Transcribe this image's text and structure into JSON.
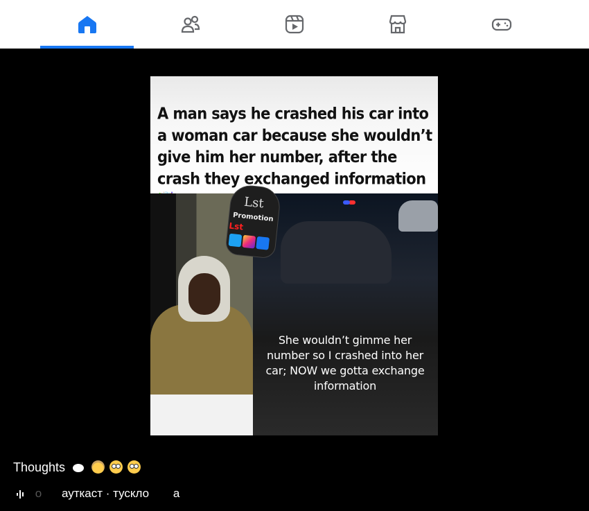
{
  "nav": {
    "tabs": [
      {
        "name": "home",
        "icon": "home-icon",
        "active": true
      },
      {
        "name": "friends",
        "icon": "friends-icon",
        "active": false
      },
      {
        "name": "reels",
        "icon": "reels-icon",
        "active": false
      },
      {
        "name": "marketplace",
        "icon": "marketplace-icon",
        "active": false
      },
      {
        "name": "gaming",
        "icon": "gaming-icon",
        "active": false
      }
    ],
    "accent_color": "#1877f2",
    "icon_color": "#65676b"
  },
  "post": {
    "image": {
      "headline": "A man says he crashed his car into a woman car because she wouldn’t give him her number, after the crash they exchanged information 🤯",
      "caption": "She wouldn’t gimme her number so I crashed into her car; NOW we gotta exchange information",
      "watermark": {
        "brand": "Lst",
        "label": "Promotion",
        "sub": "Lst"
      }
    },
    "text": "Thoughts",
    "text_emojis": [
      "thought-bubble",
      "exploding-head",
      "flushed-face",
      "flushed-face"
    ],
    "audio": {
      "prefix_faded": "о",
      "label": "аутк​аст · тускло",
      "suffix": "а"
    }
  }
}
